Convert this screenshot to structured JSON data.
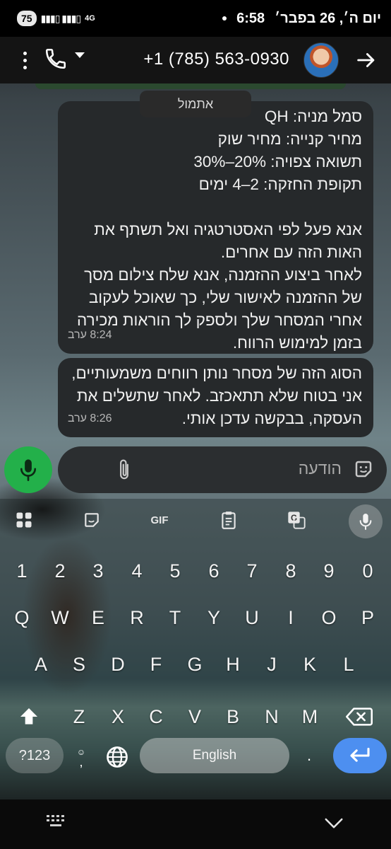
{
  "status_bar": {
    "battery": "75",
    "network": "4G",
    "time": "6:58",
    "date": "יום ה׳, 26 בפבר׳"
  },
  "header": {
    "phone_number": "+1 (785) 563-0930"
  },
  "conversation": {
    "date_divider": "אתמול",
    "messages": [
      {
        "lines": [
          "סמל מניה: QH",
          "מחיר קנייה: מחיר שוק",
          "תשואה צפויה: 20%–30%",
          "תקופת החזקה: 2–4 ימים",
          "",
          "אנא פעל לפי האסטרטגיה ואל תשתף את",
          "האות הזה עם אחרים.",
          "לאחר ביצוע ההזמנה, אנא שלח צילום מסך",
          "של ההזמנה לאישור שלי, כך שאוכל לעקוב",
          "אחרי המסחר שלך ולספק לך הוראות מכירה",
          "בזמן למימוש הרווח."
        ],
        "time": "8:24 ערב"
      },
      {
        "lines": [
          "הסוג הזה של מסחר נותן רווחים משמעותיים,",
          "אני בטוח שלא תתאכזב. לאחר שתשלים את",
          "העסקה, בבקשה עדכן אותי."
        ],
        "time": "8:26 ערב"
      }
    ]
  },
  "compose": {
    "placeholder": "הודעה"
  },
  "keyboard": {
    "toolbar": {
      "gif": "GIF"
    },
    "rows": [
      [
        "1",
        "2",
        "3",
        "4",
        "5",
        "6",
        "7",
        "8",
        "9",
        "0"
      ],
      [
        "Q",
        "W",
        "E",
        "R",
        "T",
        "Y",
        "U",
        "I",
        "O",
        "P"
      ],
      [
        "A",
        "S",
        "D",
        "F",
        "G",
        "H",
        "J",
        "K",
        "L"
      ],
      [
        "Z",
        "X",
        "C",
        "V",
        "B",
        "N",
        "M"
      ]
    ],
    "symbols_label": "?123",
    "emoji_label": ",",
    "space_label": "English",
    "period_label": "."
  }
}
